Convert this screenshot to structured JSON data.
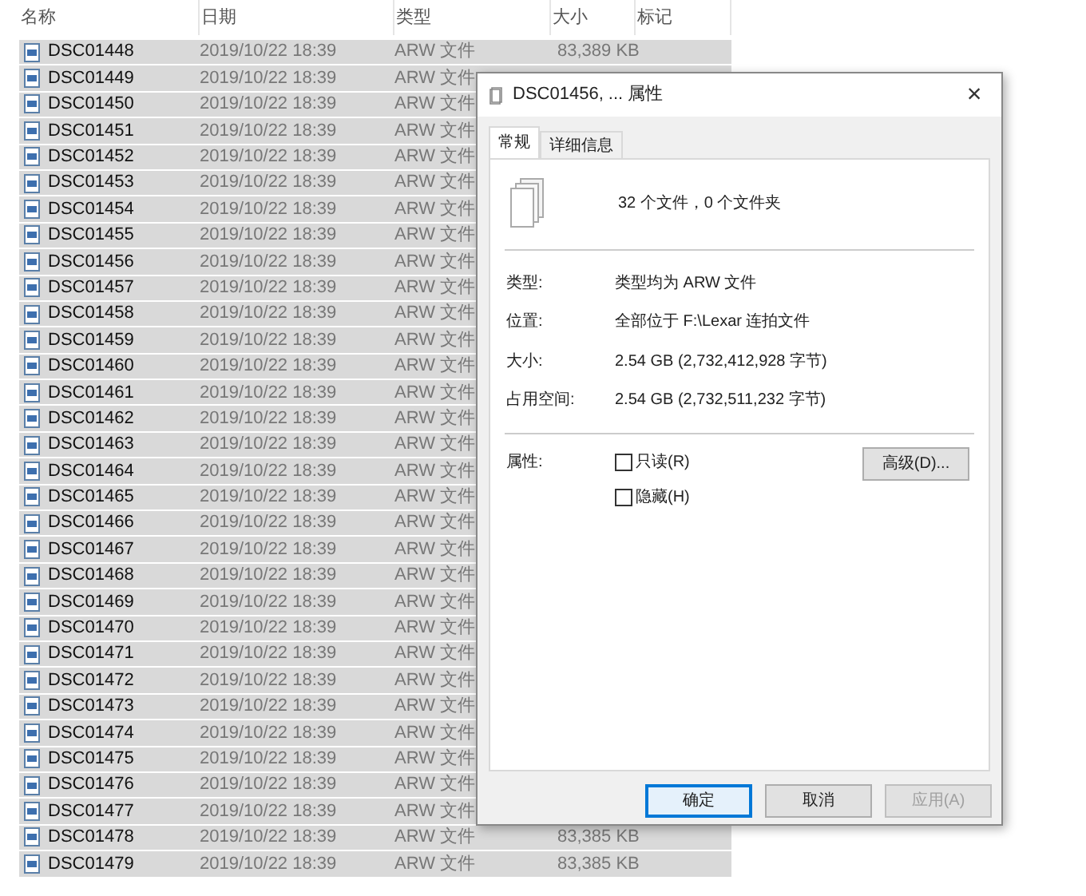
{
  "columns": [
    "名称",
    "日期",
    "类型",
    "大小",
    "标记"
  ],
  "files": [
    {
      "name": "DSC01448",
      "date": "2019/10/22 18:39",
      "type": "ARW 文件",
      "size": "83,389 KB",
      "selected": true
    },
    {
      "name": "DSC01449",
      "date": "2019/10/22 18:39",
      "type": "ARW 文件",
      "selected": true
    },
    {
      "name": "DSC01450",
      "date": "2019/10/22 18:39",
      "type": "ARW 文件",
      "selected": true
    },
    {
      "name": "DSC01451",
      "date": "2019/10/22 18:39",
      "type": "ARW 文件",
      "selected": true
    },
    {
      "name": "DSC01452",
      "date": "2019/10/22 18:39",
      "type": "ARW 文件",
      "selected": true
    },
    {
      "name": "DSC01453",
      "date": "2019/10/22 18:39",
      "type": "ARW 文件",
      "selected": true
    },
    {
      "name": "DSC01454",
      "date": "2019/10/22 18:39",
      "type": "ARW 文件",
      "selected": true
    },
    {
      "name": "DSC01455",
      "date": "2019/10/22 18:39",
      "type": "ARW 文件",
      "selected": true
    },
    {
      "name": "DSC01456",
      "date": "2019/10/22 18:39",
      "type": "ARW 文件",
      "selected": true
    },
    {
      "name": "DSC01457",
      "date": "2019/10/22 18:39",
      "type": "ARW 文件",
      "selected": true
    },
    {
      "name": "DSC01458",
      "date": "2019/10/22 18:39",
      "type": "ARW 文件",
      "selected": true
    },
    {
      "name": "DSC01459",
      "date": "2019/10/22 18:39",
      "type": "ARW 文件",
      "selected": true
    },
    {
      "name": "DSC01460",
      "date": "2019/10/22 18:39",
      "type": "ARW 文件",
      "selected": true
    },
    {
      "name": "DSC01461",
      "date": "2019/10/22 18:39",
      "type": "ARW 文件",
      "selected": true
    },
    {
      "name": "DSC01462",
      "date": "2019/10/22 18:39",
      "type": "ARW 文件",
      "selected": true
    },
    {
      "name": "DSC01463",
      "date": "2019/10/22 18:39",
      "type": "ARW 文件",
      "selected": true
    },
    {
      "name": "DSC01464",
      "date": "2019/10/22 18:39",
      "type": "ARW 文件",
      "selected": true
    },
    {
      "name": "DSC01465",
      "date": "2019/10/22 18:39",
      "type": "ARW 文件",
      "selected": true
    },
    {
      "name": "DSC01466",
      "date": "2019/10/22 18:39",
      "type": "ARW 文件",
      "selected": true
    },
    {
      "name": "DSC01467",
      "date": "2019/10/22 18:39",
      "type": "ARW 文件",
      "selected": true
    },
    {
      "name": "DSC01468",
      "date": "2019/10/22 18:39",
      "type": "ARW 文件",
      "selected": true
    },
    {
      "name": "DSC01469",
      "date": "2019/10/22 18:39",
      "type": "ARW 文件",
      "selected": true
    },
    {
      "name": "DSC01470",
      "date": "2019/10/22 18:39",
      "type": "ARW 文件",
      "selected": true
    },
    {
      "name": "DSC01471",
      "date": "2019/10/22 18:39",
      "type": "ARW 文件",
      "selected": true
    },
    {
      "name": "DSC01472",
      "date": "2019/10/22 18:39",
      "type": "ARW 文件",
      "selected": true
    },
    {
      "name": "DSC01473",
      "date": "2019/10/22 18:39",
      "type": "ARW 文件",
      "selected": true
    },
    {
      "name": "DSC01474",
      "date": "2019/10/22 18:39",
      "type": "ARW 文件",
      "selected": true
    },
    {
      "name": "DSC01475",
      "date": "2019/10/22 18:39",
      "type": "ARW 文件",
      "selected": true
    },
    {
      "name": "DSC01476",
      "date": "2019/10/22 18:39",
      "type": "ARW 文件",
      "selected": true
    },
    {
      "name": "DSC01477",
      "date": "2019/10/22 18:39",
      "type": "ARW 文件",
      "selected": true
    },
    {
      "name": "DSC01478",
      "date": "2019/10/22 18:39",
      "type": "ARW 文件",
      "size": "83,385 KB",
      "selected": true
    },
    {
      "name": "DSC01479",
      "date": "2019/10/22 18:39",
      "type": "ARW 文件",
      "size": "83,385 KB",
      "selected": true
    }
  ],
  "dialog": {
    "title": "DSC01456, ... 属性",
    "close": "×",
    "tabs": [
      {
        "label": "常规",
        "selected": true
      },
      {
        "label": "详细信息",
        "selected": false
      }
    ],
    "summary": "32 个文件，0 个文件夹",
    "properties": [
      {
        "label": "类型:",
        "value": "类型均为 ARW 文件"
      },
      {
        "label": "位置:",
        "value": "全部位于 F:\\Lexar 连拍文件"
      },
      {
        "label": "大小:",
        "value": "2.54 GB (2,732,412,928 字节)"
      },
      {
        "label": "占用空间:",
        "value": "2.54 GB (2,732,511,232 字节)"
      }
    ],
    "attributes_label": "属性:",
    "attributes": [
      {
        "label": "只读(R)",
        "checked": false
      },
      {
        "label": "隐藏(H)",
        "checked": false
      }
    ],
    "advanced_button": "高级(D)...",
    "buttons": [
      {
        "label": "确定",
        "kind": "default",
        "disabled": false
      },
      {
        "label": "取消",
        "kind": "normal",
        "disabled": false
      },
      {
        "label": "应用(A)",
        "kind": "normal",
        "disabled": true
      }
    ]
  }
}
